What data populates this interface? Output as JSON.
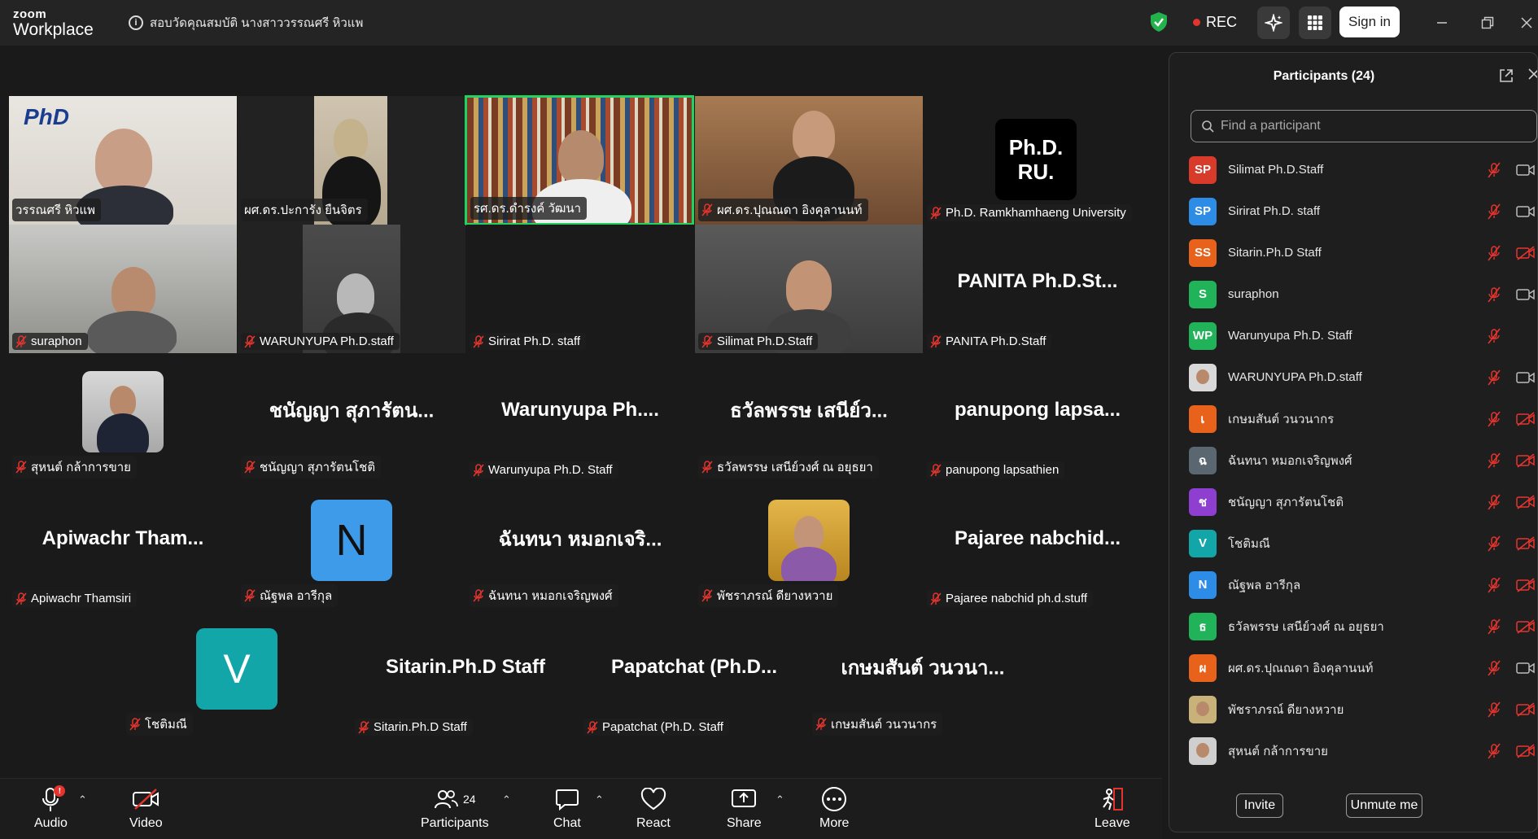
{
  "app": {
    "brand_top": "zoom",
    "brand_bottom": "Workplace"
  },
  "meeting": {
    "title": "สอบวัดคุณสมบัติ นางสาววรรณศรี หิวแพ",
    "info_icon": "i"
  },
  "topbar": {
    "rec_label": "REC",
    "signin_label": "Sign in"
  },
  "gallery": {
    "row1": [
      {
        "name": "วรรณศรี หิวแพ",
        "muted": false,
        "video": true
      },
      {
        "name": "ผศ.ดร.ปะการัง ยืนจิตร",
        "muted": false,
        "video": true
      },
      {
        "name": "รศ.ดร.ดำรงค์ วัฒนา",
        "muted": false,
        "video": true
      },
      {
        "name": "ผศ.ดร.ปุณณดา อิงคุลานนท์",
        "muted": true,
        "video": true
      },
      {
        "name": "Ph.D. Ramkhamhaeng University",
        "muted": true,
        "video": false,
        "logo_text_1": "Ph.D.",
        "logo_text_2": "RU."
      }
    ],
    "row2": [
      {
        "name": "suraphon",
        "muted": true,
        "video": true
      },
      {
        "name": "WARUNYUPA Ph.D.staff",
        "muted": true,
        "video": true
      },
      {
        "name": "Sirirat Ph.D. staff",
        "muted": true,
        "video": false
      },
      {
        "name": "Silimat Ph.D.Staff",
        "muted": true,
        "video": true
      },
      {
        "name": "PANITA Ph.D.Staff",
        "muted": true,
        "video": false,
        "big": "PANITA Ph.D.St..."
      }
    ],
    "row3": [
      {
        "name": "สุหนต์ กล้าการขาย",
        "muted": true
      },
      {
        "name": "ชนัญญา สุภารัตนโชติ",
        "muted": true,
        "big": "ชนัญญา สุภารัตน..."
      },
      {
        "name": "Warunyupa Ph.D. Staff",
        "muted": true,
        "big": "Warunyupa Ph...."
      },
      {
        "name": "ธวัลพรรษ เสนีย์วงศ์ ณ อยุธยา",
        "muted": true,
        "big": "ธวัลพรรษ เสนีย์ว..."
      },
      {
        "name": "panupong lapsathien",
        "muted": true,
        "big": "panupong lapsa..."
      }
    ],
    "row4": [
      {
        "name": "Apiwachr Thamsiri",
        "muted": true,
        "big": "Apiwachr Tham..."
      },
      {
        "name": "ณัฐพล อารีกุล",
        "muted": true,
        "avatar": "N"
      },
      {
        "name": "ฉันทนา หมอกเจริญพงศ์",
        "muted": true,
        "big": "ฉันทนา หมอกเจริ..."
      },
      {
        "name": "พัชราภรณ์ ดียางหวาย",
        "muted": true
      },
      {
        "name": "Pajaree nabchid ph.d.stuff",
        "muted": true,
        "big": "Pajaree nabchid..."
      }
    ],
    "row5": [
      {
        "name": "โชติมณี",
        "muted": true,
        "avatar": "V"
      },
      {
        "name": "Sitarin.Ph.D Staff",
        "muted": true,
        "big": "Sitarin.Ph.D Staff"
      },
      {
        "name": "Papatchat (Ph.D. Staff",
        "muted": true,
        "big": "Papatchat (Ph.D..."
      },
      {
        "name": "เกษมสันต์ วนวนากร",
        "muted": true,
        "big": "เกษมสันต์ วนวนา..."
      }
    ]
  },
  "toolbar": {
    "audio": "Audio",
    "audio_badge": "!",
    "video": "Video",
    "participants": "Participants",
    "participants_count": "24",
    "chat": "Chat",
    "react": "React",
    "share": "Share",
    "more": "More",
    "leave": "Leave"
  },
  "panel": {
    "title": "Participants (24)",
    "search_placeholder": "Find a participant",
    "invite": "Invite",
    "unmute": "Unmute me",
    "participants": [
      {
        "initials": "SP",
        "name": "Silimat Ph.D.Staff",
        "color": "#d93b2b",
        "cam": "on"
      },
      {
        "initials": "SP",
        "name": "Sirirat Ph.D. staff",
        "color": "#2d8ce6",
        "cam": "on"
      },
      {
        "initials": "SS",
        "name": "Sitarin.Ph.D Staff",
        "color": "#e8621c",
        "cam": "off"
      },
      {
        "initials": "S",
        "name": "suraphon",
        "color": "#21b35a",
        "cam": "on"
      },
      {
        "initials": "WP",
        "name": "Warunyupa Ph.D. Staff",
        "color": "#21b35a",
        "cam": "none"
      },
      {
        "initials": "",
        "name": "WARUNYUPA Ph.D.staff",
        "color": "#d9d9d9",
        "cam": "on",
        "photo": true
      },
      {
        "initials": "เ",
        "name": "เกษมสันต์ วนวนากร",
        "color": "#e8621c",
        "cam": "off"
      },
      {
        "initials": "ฉ",
        "name": "ฉันทนา หมอกเจริญพงศ์",
        "color": "#5b6770",
        "cam": "off"
      },
      {
        "initials": "ช",
        "name": "ชนัญญา สุภารัตนโชติ",
        "color": "#8e3fcf",
        "cam": "off"
      },
      {
        "initials": "V",
        "name": "โชติมณี",
        "color": "#13a6a8",
        "cam": "off"
      },
      {
        "initials": "N",
        "name": "ณัฐพล อารีกุล",
        "color": "#2d8ce6",
        "cam": "off"
      },
      {
        "initials": "ธ",
        "name": "ธวัลพรรษ เสนีย์วงศ์ ณ อยุธยา",
        "color": "#21b35a",
        "cam": "off"
      },
      {
        "initials": "ผ",
        "name": "ผศ.ดร.ปุณณดา อิงคุลานนท์",
        "color": "#e8621c",
        "cam": "on"
      },
      {
        "initials": "",
        "name": "พัชราภรณ์ ดียางหวาย",
        "color": "#c9b27a",
        "cam": "off",
        "photo": true
      },
      {
        "initials": "",
        "name": "สุหนต์ กล้าการขาย",
        "color": "#cfcfcf",
        "cam": "off",
        "photo": true
      }
    ]
  },
  "colors": {
    "speaking_border": "#23d160",
    "muted_red": "#e5342e",
    "bg": "#1a1a1a"
  }
}
